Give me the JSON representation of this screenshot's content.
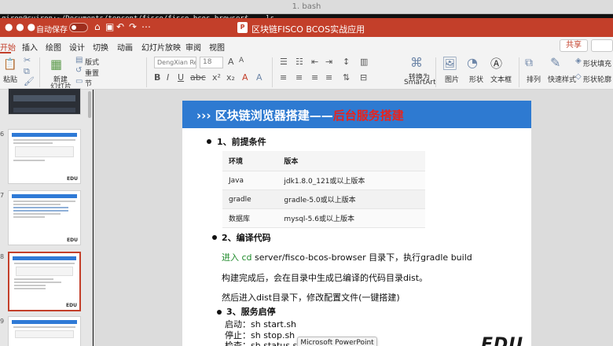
{
  "terminal": {
    "title": "1. bash",
    "prompt": "qiron@cuiron:~/Documents/tencent/fisco/fisco-bcos-browser$",
    "command": "ls"
  },
  "titlebar": {
    "autosave_label": "自动保存",
    "doc_title": "区块链FISCO BCOS实战应用"
  },
  "menu": {
    "items": [
      "开始",
      "插入",
      "绘图",
      "设计",
      "切换",
      "动画",
      "幻灯片放映",
      "审阅",
      "视图"
    ],
    "share_label": "共享"
  },
  "ribbon": {
    "paste": "粘贴",
    "new_slide_line1": "新建",
    "new_slide_line2": "幻灯片",
    "layout": "版式",
    "reset": "重置",
    "section": "节",
    "font_name": "DengXian Regular (正文)",
    "font_size": "18",
    "smartart_line1": "转换为",
    "smartart_line2": "SmartArt",
    "picture": "图片",
    "shape": "形状",
    "textbox": "文本框",
    "arrange": "排列",
    "quick_styles": "快速样式",
    "shape_fill": "形状填充",
    "shape_outline": "形状轮廓"
  },
  "thumbnails": [
    {
      "num": "",
      "edu": ""
    },
    {
      "num": "6",
      "edu": "EDU"
    },
    {
      "num": "7",
      "edu": "EDU"
    },
    {
      "num": "8",
      "edu": "EDU"
    },
    {
      "num": "9",
      "edu": ""
    }
  ],
  "slide": {
    "title_prefix": "››› 区块链浏览器搭建——",
    "title_highlight": "后台服务搭建",
    "section1": "1、前提条件",
    "table": {
      "headers": [
        "环境",
        "版本"
      ],
      "rows": [
        [
          "Java",
          "jdk1.8.0_121或以上版本"
        ],
        [
          "gradle",
          "gradle-5.0或以上版本"
        ],
        [
          "数据库",
          "mysql-5.6或以上版本"
        ]
      ]
    },
    "section2": "2、编译代码",
    "cmd_line_green": "进入 cd",
    "cmd_line_rest": " server/fisco-bcos-browser 目录下，执行",
    "cmd_line_build": "gradle build",
    "build_note": "构建完成后，会在目录中生成已编译的代码目录dist。",
    "config_note": "然后进入dist目录下，修改配置文件(一键搭建)",
    "section3": "3、服务启停",
    "start_line": "启动：sh start.sh",
    "stop_line": "停止：sh stop.sh",
    "check_line": "检查：sh status.sh",
    "watermark": "EDU"
  },
  "tooltip": "Microsoft PowerPoint"
}
